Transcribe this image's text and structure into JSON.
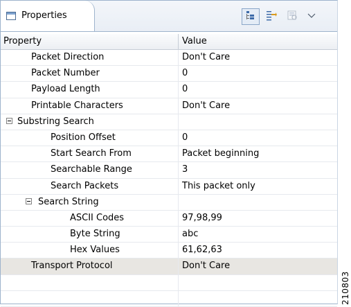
{
  "view": {
    "title": "Properties",
    "icons": [
      "properties-view-icon"
    ]
  },
  "toolbar": {
    "buttons": [
      {
        "icon": "show-categories-icon",
        "state": "active"
      },
      {
        "icon": "show-advanced-properties-icon",
        "state": "normal"
      },
      {
        "icon": "restore-default-value-icon",
        "state": "disabled"
      }
    ],
    "menu_icon": "view-menu-chevron-icon"
  },
  "table": {
    "headers": {
      "property": "Property",
      "value": "Value"
    },
    "rows": [
      {
        "property": "Packet Direction",
        "value": "Don't Care",
        "indent": 1
      },
      {
        "property": "Packet Number",
        "value": "0",
        "indent": 1
      },
      {
        "property": "Payload Length",
        "value": "0",
        "indent": 1
      },
      {
        "property": "Printable Characters",
        "value": "Don't Care",
        "indent": 1
      },
      {
        "property": "Substring Search",
        "value": "",
        "indent": 0,
        "expanded": true
      },
      {
        "property": "Position Offset",
        "value": "0",
        "indent": 2
      },
      {
        "property": "Start Search From",
        "value": "Packet beginning",
        "indent": 2
      },
      {
        "property": "Searchable Range",
        "value": "3",
        "indent": 2
      },
      {
        "property": "Search Packets",
        "value": "This packet only",
        "indent": 2
      },
      {
        "property": "Search String",
        "value": "",
        "indent": 1,
        "expanded": true
      },
      {
        "property": "ASCII Codes",
        "value": "97,98,99",
        "indent": 3
      },
      {
        "property": "Byte String",
        "value": "abc",
        "indent": 3
      },
      {
        "property": "Hex Values",
        "value": "61,62,63",
        "indent": 3
      },
      {
        "property": "Transport Protocol",
        "value": "Don't Care",
        "indent": 1,
        "selected": true
      }
    ]
  },
  "watermark": "210803"
}
